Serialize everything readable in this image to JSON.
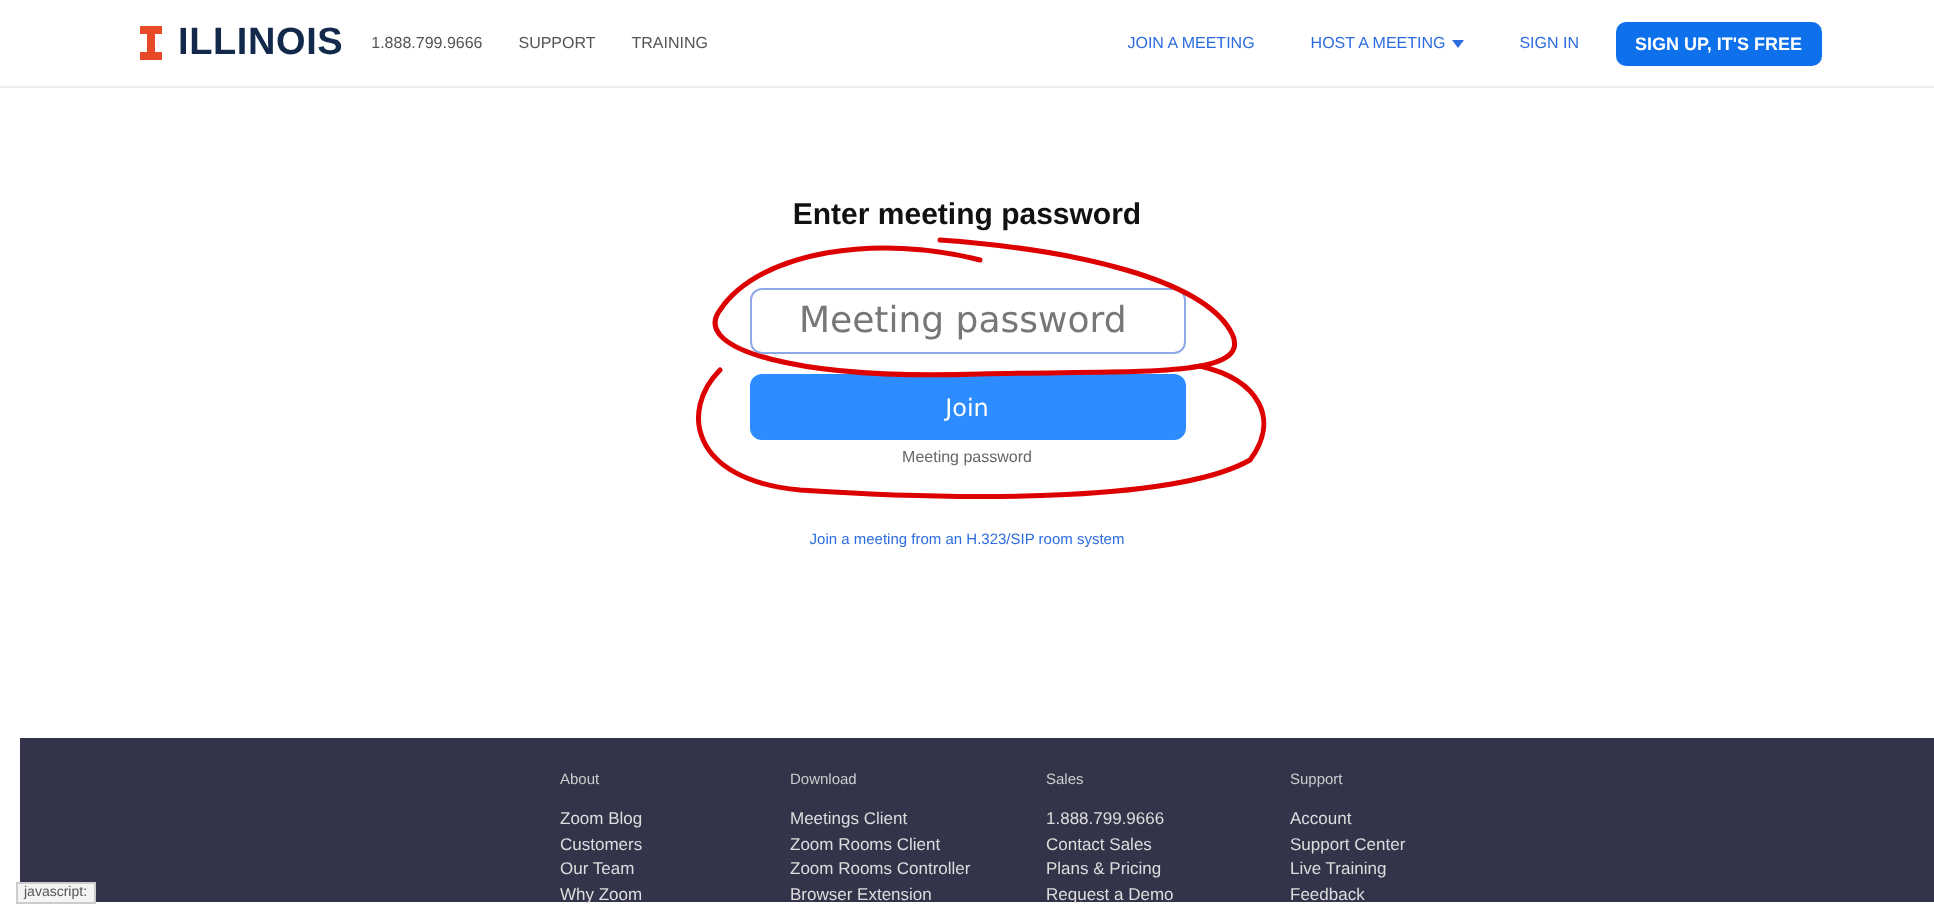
{
  "header": {
    "logo": "ILLINOIS",
    "phone": "1.888.799.9666",
    "nav_left": [
      "SUPPORT",
      "TRAINING"
    ],
    "nav_right": [
      {
        "label": "JOIN A MEETING",
        "kind": "link"
      },
      {
        "label": "HOST A MEETING",
        "kind": "dropdown"
      },
      {
        "label": "SIGN IN",
        "kind": "link"
      }
    ],
    "signup_button": "SIGN UP, IT'S FREE"
  },
  "form": {
    "title": "Enter meeting password",
    "password_field": {
      "placeholder": "Meeting password"
    },
    "join_button": "Join",
    "hint": "Meeting password",
    "room_link": "Join a meeting from an H.323/SIP room system"
  },
  "footer": {
    "columns": [
      {
        "heading": "About",
        "links": [
          "Zoom Blog",
          "Customers",
          "Our Team",
          "Why Zoom"
        ]
      },
      {
        "heading": "Download",
        "links": [
          "Meetings Client",
          "Zoom Rooms Client",
          "Zoom Rooms Controller",
          "Browser Extension"
        ]
      },
      {
        "heading": "Sales",
        "links": [
          "1.888.799.9666",
          "Contact Sales",
          "Plans & Pricing",
          "Request a Demo"
        ]
      },
      {
        "heading": "Support",
        "links": [
          "Account",
          "Support Center",
          "Live Training",
          "Feedback"
        ]
      }
    ]
  },
  "status_bar": {
    "url": "javascript:"
  }
}
